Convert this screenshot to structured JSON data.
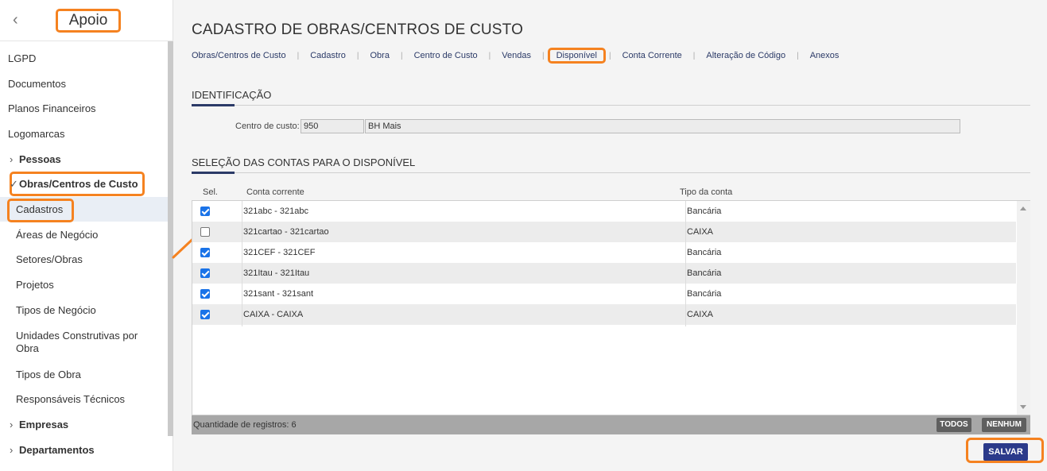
{
  "sidebar": {
    "title": "Apoio",
    "items": [
      {
        "label": "LGPD"
      },
      {
        "label": "Documentos"
      },
      {
        "label": "Planos Financeiros"
      },
      {
        "label": "Logomarcas"
      },
      {
        "label": "Pessoas"
      },
      {
        "label": "Obras/Centros de Custo"
      },
      {
        "label": "Cadastros"
      },
      {
        "label": "Áreas de Negócio"
      },
      {
        "label": "Setores/Obras"
      },
      {
        "label": "Projetos"
      },
      {
        "label": "Tipos de Negócio"
      },
      {
        "label": "Unidades Construtivas por Obra"
      },
      {
        "label": "Tipos de Obra"
      },
      {
        "label": "Responsáveis Técnicos"
      },
      {
        "label": "Empresas"
      },
      {
        "label": "Departamentos"
      }
    ]
  },
  "page": {
    "title": "CADASTRO DE OBRAS/CENTROS DE CUSTO",
    "tabs": [
      {
        "label": "Obras/Centros de Custo"
      },
      {
        "label": "Cadastro"
      },
      {
        "label": "Obra"
      },
      {
        "label": "Centro de Custo"
      },
      {
        "label": "Vendas"
      },
      {
        "label": "Disponível"
      },
      {
        "label": "Conta Corrente"
      },
      {
        "label": "Alteração de Código"
      },
      {
        "label": "Anexos"
      }
    ],
    "active_tab": "Disponível"
  },
  "identificacao": {
    "title": "IDENTIFICAÇÃO",
    "label": "Centro de custo:",
    "code": "950",
    "name": "BH Mais"
  },
  "selecao": {
    "title": "SELEÇÃO DAS CONTAS PARA O DISPONÍVEL",
    "headers": {
      "sel": "Sel.",
      "conta": "Conta corrente",
      "tipo": "Tipo da conta"
    },
    "rows": [
      {
        "checked": true,
        "conta": "321abc - 321abc",
        "tipo": "Bancária"
      },
      {
        "checked": false,
        "conta": "321cartao - 321cartao",
        "tipo": "CAIXA"
      },
      {
        "checked": true,
        "conta": "321CEF - 321CEF",
        "tipo": "Bancária"
      },
      {
        "checked": true,
        "conta": "321Itau - 321Itau",
        "tipo": "Bancária"
      },
      {
        "checked": true,
        "conta": "321sant - 321sant",
        "tipo": "Bancária"
      },
      {
        "checked": true,
        "conta": "CAIXA - CAIXA",
        "tipo": "CAIXA"
      }
    ],
    "count_label": "Quantidade de registros: 6",
    "btn_todos": "TODOS",
    "btn_nenhum": "NENHUM"
  },
  "actions": {
    "save": "SALVAR"
  },
  "colors": {
    "accent": "#f58220",
    "primary": "#2b3a8a",
    "check": "#1a73e8"
  }
}
